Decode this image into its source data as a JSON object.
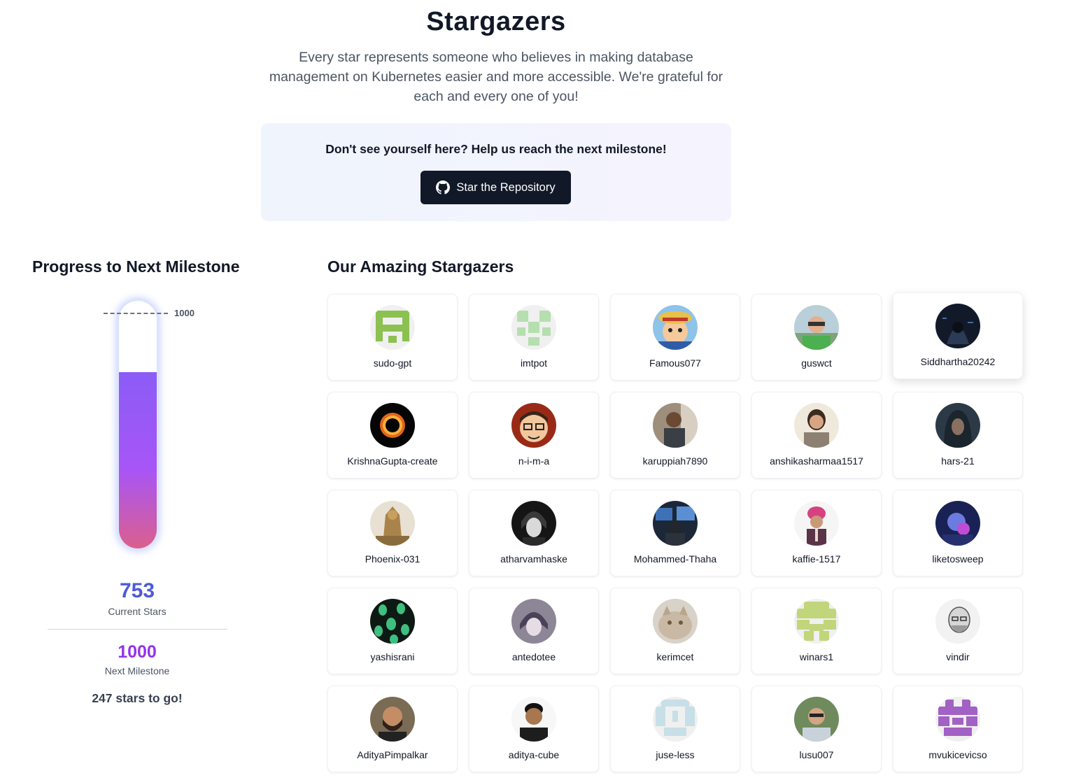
{
  "header": {
    "title": "Stargazers",
    "intro": "Every star represents someone who believes in making database management on Kubernetes easier and more accessible. We're grateful for each and every one of you!"
  },
  "cta": {
    "text": "Don't see yourself here? Help us reach the next milestone!",
    "button_label": "Star the Repository",
    "button_icon": "github-icon"
  },
  "progress": {
    "title": "Progress to Next Milestone",
    "current": 753,
    "goal": 1000,
    "goal_marker": "1000",
    "current_value": "753",
    "current_label": "Current Stars",
    "next_value": "1000",
    "next_label": "Next Milestone",
    "remaining_text": "247 stars to go!",
    "fill_colors": [
      "#8b5cf6",
      "#a855f7",
      "#db5f8d"
    ]
  },
  "stargazers": {
    "title": "Our Amazing Stargazers",
    "users": [
      {
        "name": "sudo-gpt",
        "avatar": "identicon-green"
      },
      {
        "name": "imtpot",
        "avatar": "identicon-lightgreen"
      },
      {
        "name": "Famous077",
        "avatar": "photo-anime"
      },
      {
        "name": "guswct",
        "avatar": "photo-person-outdoor"
      },
      {
        "name": "Siddhartha20242",
        "avatar": "photo-hooded-dark"
      },
      {
        "name": "KrishnaGupta-create",
        "avatar": "photo-black-hole"
      },
      {
        "name": "n-i-m-a",
        "avatar": "cartoon-face"
      },
      {
        "name": "karuppiah7890",
        "avatar": "photo-person"
      },
      {
        "name": "anshikasharmaa1517",
        "avatar": "photo-person-light"
      },
      {
        "name": "hars-21",
        "avatar": "photo-hooded"
      },
      {
        "name": "Phoenix-031",
        "avatar": "photo-statue"
      },
      {
        "name": "atharvamhaske",
        "avatar": "photo-anime-dark"
      },
      {
        "name": "Mohammed-Thaha",
        "avatar": "photo-desk"
      },
      {
        "name": "kaffie-1517",
        "avatar": "photo-person-turban"
      },
      {
        "name": "liketosweep",
        "avatar": "photo-neon"
      },
      {
        "name": "yashisrani",
        "avatar": "photo-aliens"
      },
      {
        "name": "antedotee",
        "avatar": "photo-anime-purple"
      },
      {
        "name": "kerimcet",
        "avatar": "photo-cat"
      },
      {
        "name": "winars1",
        "avatar": "identicon-yellowgreen"
      },
      {
        "name": "vindir",
        "avatar": "sketch-portrait"
      },
      {
        "name": "AdityaPimpalkar",
        "avatar": "photo-person-beard"
      },
      {
        "name": "aditya-cube",
        "avatar": "photo-person-smile"
      },
      {
        "name": "juse-less",
        "avatar": "identicon-blue"
      },
      {
        "name": "lusu007",
        "avatar": "photo-person-glasses"
      },
      {
        "name": "mvukicevicso",
        "avatar": "identicon-purple"
      }
    ]
  }
}
